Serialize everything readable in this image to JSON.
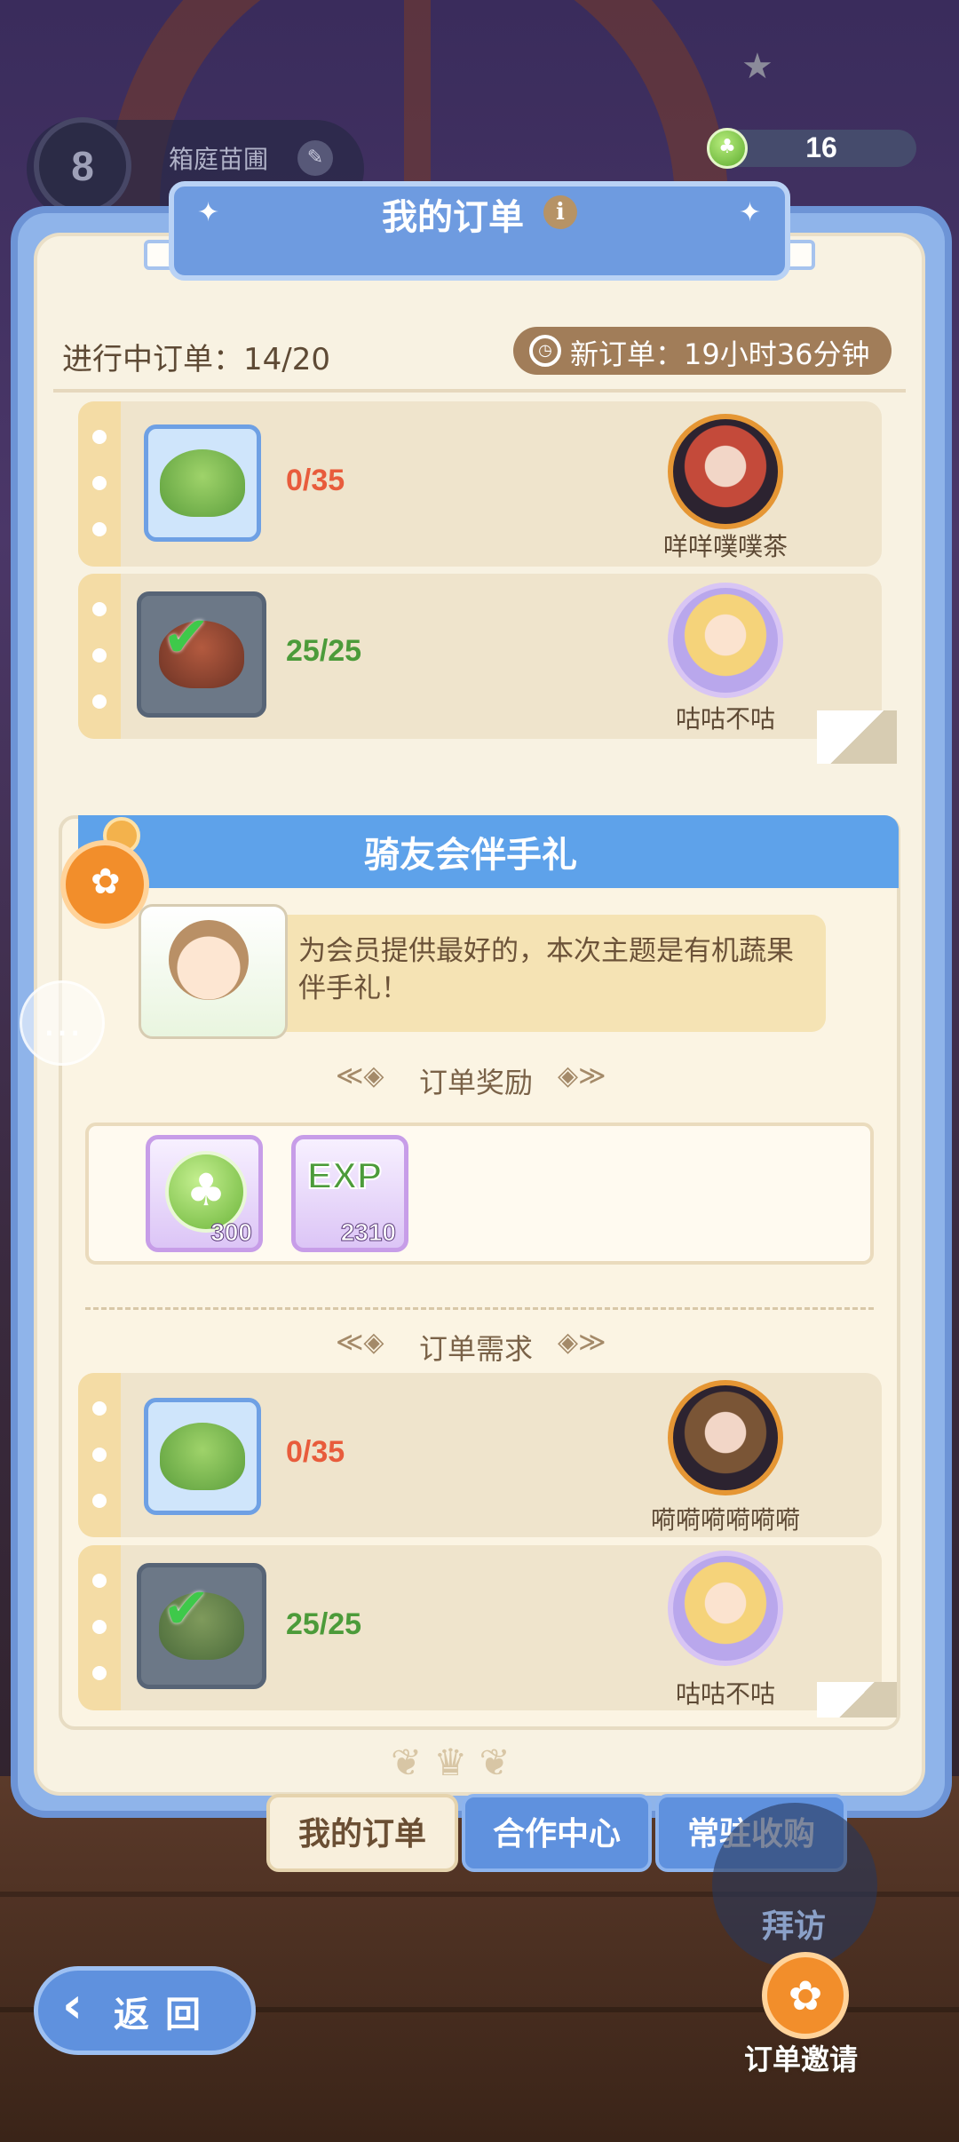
{
  "header": {
    "player_level": "8",
    "player_name": "箱庭苗圃",
    "currency_value": "16",
    "title": "我的订单",
    "info_glyph": "i"
  },
  "status": {
    "in_progress_label": "进行中订单：14/20",
    "new_order_label": "新订单：19小时36分钟"
  },
  "order1": {
    "requirements": [
      {
        "item_icon": "coconut-drink-icon",
        "progress": "0/35",
        "complete": false,
        "customer": "咩咩噗噗茶"
      },
      {
        "item_icon": "witch-tomato-icon",
        "progress": "25/25",
        "complete": true,
        "customer": "咕咕不咕"
      }
    ]
  },
  "order2": {
    "title": "骑友会伴手礼",
    "npc_message": "为会员提供最好的，本次主题是有机蔬果伴手礼！",
    "rewards_heading": "订单奖励",
    "rewards": [
      {
        "icon": "clover-coin-icon",
        "qty": "300"
      },
      {
        "icon": "exp-icon",
        "label": "EXP",
        "qty": "2310"
      }
    ],
    "requirements_heading": "订单需求",
    "requirements": [
      {
        "item_icon": "coconut-drink-icon",
        "progress": "0/35",
        "complete": false,
        "customer": "嗬嗬嗬嗬嗬嗬"
      },
      {
        "item_icon": "pea-pod-icon",
        "progress": "25/25",
        "complete": true,
        "customer": "咕咕不咕"
      }
    ]
  },
  "tabs": [
    {
      "label": "我的订单",
      "active": true
    },
    {
      "label": "合作中心",
      "active": false
    },
    {
      "label": "常驻收购",
      "active": false
    }
  ],
  "footer": {
    "back_label": "返回",
    "visit_label": "拜访",
    "invite_label": "订单邀请"
  },
  "colors": {
    "panel_blue": "#8fb4ea",
    "header_blue": "#5ea2ea",
    "parchment": "#f8f2e2",
    "progress_incomplete": "#e85c3c",
    "progress_complete": "#4c9b3a",
    "accent_orange": "#f28e2b"
  }
}
